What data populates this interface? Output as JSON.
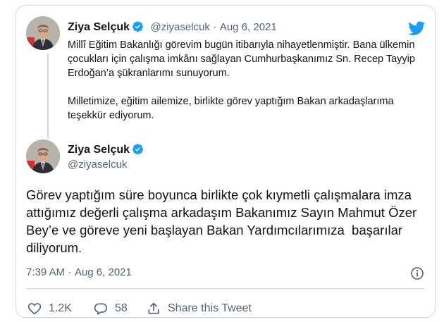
{
  "quoted_tweet": {
    "display_name": "Ziya Selçuk",
    "handle": "@ziyaselcuk",
    "separator": "·",
    "date": "Aug 6, 2021",
    "paragraph1": "Millî Eğitim Bakanlığı görevim bugün itibarıyla nihayetlenmiştir. Bana ülkemin çocukları için çalışma imkânı sağlayan Cumhurbaşkanımız Sn. Recep Tayyip Erdoğan’a şükranlarımı sunuyorum.",
    "paragraph2": "Milletimize, eğitim ailemize, birlikte görev yaptığım Bakan arkadaşlarıma teşekkür ediyorum."
  },
  "main_tweet": {
    "display_name": "Ziya Selçuk",
    "handle": "@ziyaselcuk",
    "text": "Görev yaptığım süre boyunca birlikte çok kıymetli çalışmalara imza attığımız değerli çalışma arkadaşım Bakanımız Sayın Mahmut Özer Bey’e ve göreve yeni başlayan Bakan Yardımcılarımıza  başarılar diliyorum.",
    "time": "7:39 AM",
    "separator": "·",
    "date": "Aug 6, 2021"
  },
  "actions": {
    "likes": "1.2K",
    "replies": "58",
    "share_label": "Share this Tweet"
  },
  "icons": {
    "brand": "twitter-bird-icon",
    "verified": "verified-badge-icon",
    "info": "info-icon",
    "like": "heart-icon",
    "reply": "reply-bubble-icon",
    "share": "share-icon"
  },
  "colors": {
    "accent": "#1d9bf0",
    "text": "#0f1419",
    "muted": "#536471",
    "border": "#cfd9de"
  }
}
